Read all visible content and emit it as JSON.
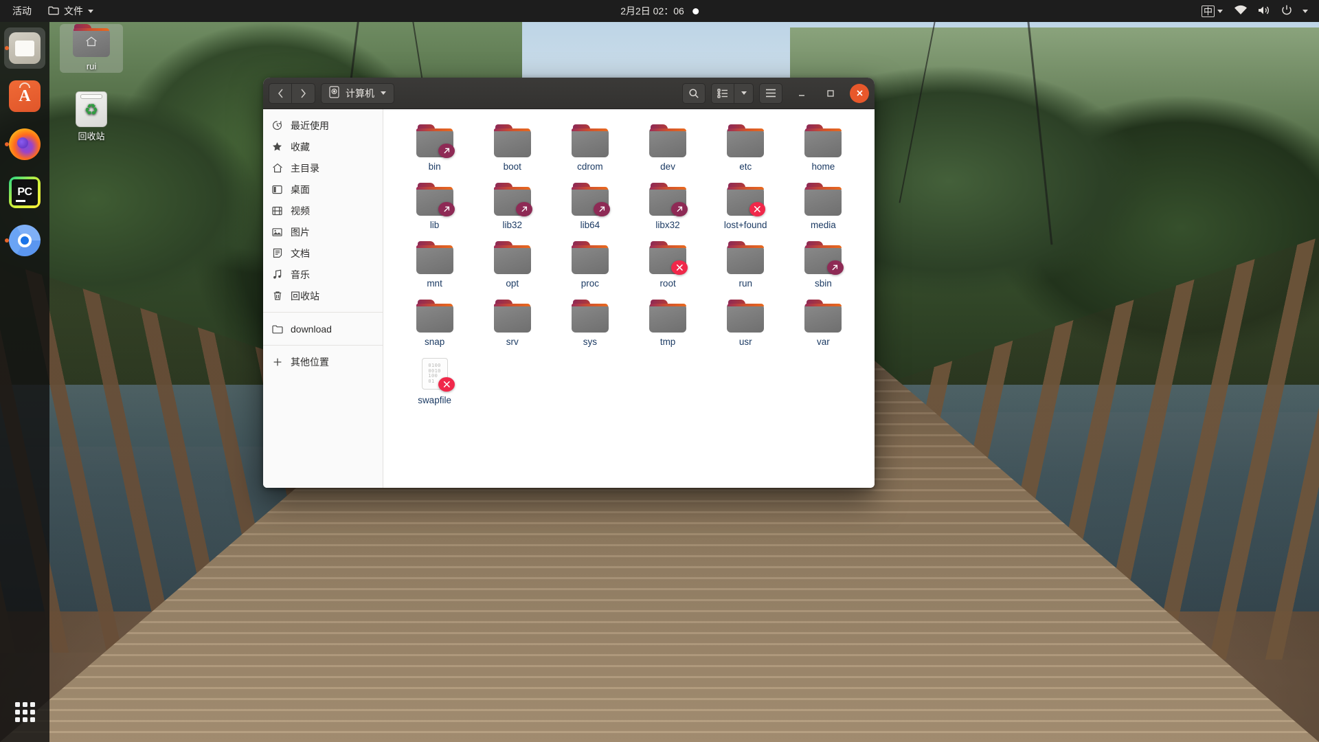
{
  "topbar": {
    "activities": "活动",
    "app_menu": "文件",
    "app_menu_icon": "folder-icon",
    "clock": "2月2日  02：06",
    "notification_dot": "notification-indicator",
    "ime": "中",
    "icons": [
      "wifi-icon",
      "volume-icon",
      "power-icon",
      "chevron-down-icon"
    ]
  },
  "dock": {
    "items": [
      {
        "name": "files",
        "icon": "files-icon",
        "running": true,
        "active": true
      },
      {
        "name": "ubuntu-software",
        "icon": "ubuntu-software-icon",
        "running": false,
        "active": false
      },
      {
        "name": "firefox",
        "icon": "firefox-icon",
        "running": true,
        "active": false
      },
      {
        "name": "pycharm",
        "icon": "pycharm-icon",
        "label": "PC",
        "running": false,
        "active": false
      },
      {
        "name": "chromium",
        "icon": "chromium-icon",
        "running": true,
        "active": false
      }
    ],
    "show_apps": "show-applications-grid"
  },
  "desktop": {
    "icons": [
      {
        "name": "rui",
        "label": "rui",
        "type": "home-folder",
        "selected": true
      },
      {
        "name": "trash",
        "label": "回收站",
        "type": "trash",
        "selected": false
      }
    ]
  },
  "file_manager": {
    "title": "计算机",
    "path_icon": "drive-icon",
    "nav": {
      "back": "back-icon",
      "forward": "forward-icon"
    },
    "toolbar": {
      "search": "search-icon",
      "view_list": "list-view-icon",
      "view_dropdown": "chevron-down-icon",
      "menu": "hamburger-menu-icon",
      "minimize": "minimize-icon",
      "maximize": "maximize-icon",
      "close": "close-icon"
    },
    "sidebar": [
      {
        "label": "最近使用",
        "icon": "clock-icon"
      },
      {
        "label": "收藏",
        "icon": "star-icon"
      },
      {
        "label": "主目录",
        "icon": "home-icon"
      },
      {
        "label": "桌面",
        "icon": "desktop-icon"
      },
      {
        "label": "视频",
        "icon": "video-icon"
      },
      {
        "label": "图片",
        "icon": "image-icon"
      },
      {
        "label": "文档",
        "icon": "document-icon"
      },
      {
        "label": "音乐",
        "icon": "music-icon"
      },
      {
        "label": "回收站",
        "icon": "trash-icon"
      },
      {
        "separator": true
      },
      {
        "label": "download",
        "icon": "folder-icon"
      },
      {
        "separator": true
      },
      {
        "label": "其他位置",
        "icon": "plus-icon"
      }
    ],
    "items": [
      {
        "name": "bin",
        "type": "folder",
        "badge": "link"
      },
      {
        "name": "boot",
        "type": "folder",
        "badge": "none"
      },
      {
        "name": "cdrom",
        "type": "folder",
        "badge": "none"
      },
      {
        "name": "dev",
        "type": "folder",
        "badge": "none"
      },
      {
        "name": "etc",
        "type": "folder",
        "badge": "none"
      },
      {
        "name": "home",
        "type": "folder",
        "badge": "none"
      },
      {
        "name": "lib",
        "type": "folder",
        "badge": "link"
      },
      {
        "name": "lib32",
        "type": "folder",
        "badge": "link"
      },
      {
        "name": "lib64",
        "type": "folder",
        "badge": "link"
      },
      {
        "name": "libx32",
        "type": "folder",
        "badge": "link"
      },
      {
        "name": "lost+found",
        "type": "folder",
        "badge": "deny"
      },
      {
        "name": "media",
        "type": "folder",
        "badge": "none"
      },
      {
        "name": "mnt",
        "type": "folder",
        "badge": "none"
      },
      {
        "name": "opt",
        "type": "folder",
        "badge": "none"
      },
      {
        "name": "proc",
        "type": "folder",
        "badge": "none"
      },
      {
        "name": "root",
        "type": "folder",
        "badge": "deny"
      },
      {
        "name": "run",
        "type": "folder",
        "badge": "none"
      },
      {
        "name": "sbin",
        "type": "folder",
        "badge": "link"
      },
      {
        "name": "snap",
        "type": "folder",
        "badge": "none"
      },
      {
        "name": "srv",
        "type": "folder",
        "badge": "none"
      },
      {
        "name": "sys",
        "type": "folder",
        "badge": "none"
      },
      {
        "name": "tmp",
        "type": "folder",
        "badge": "none"
      },
      {
        "name": "usr",
        "type": "folder",
        "badge": "none"
      },
      {
        "name": "var",
        "type": "folder",
        "badge": "none"
      },
      {
        "name": "swapfile",
        "type": "binary-file",
        "badge": "deny",
        "bits": [
          "0100",
          "0010",
          "100",
          "01"
        ]
      }
    ]
  },
  "colors": {
    "accent_orange": "#e8582b",
    "folder_grey": "#7c7c7c",
    "folder_tab": "#8e2a55",
    "deny_red": "#f0284a",
    "link_purple": "#8e2a55",
    "topbar_bg": "#1d1d1d",
    "titlebar_bg": "#3b3a38",
    "filename_blue": "#1b3a63"
  }
}
